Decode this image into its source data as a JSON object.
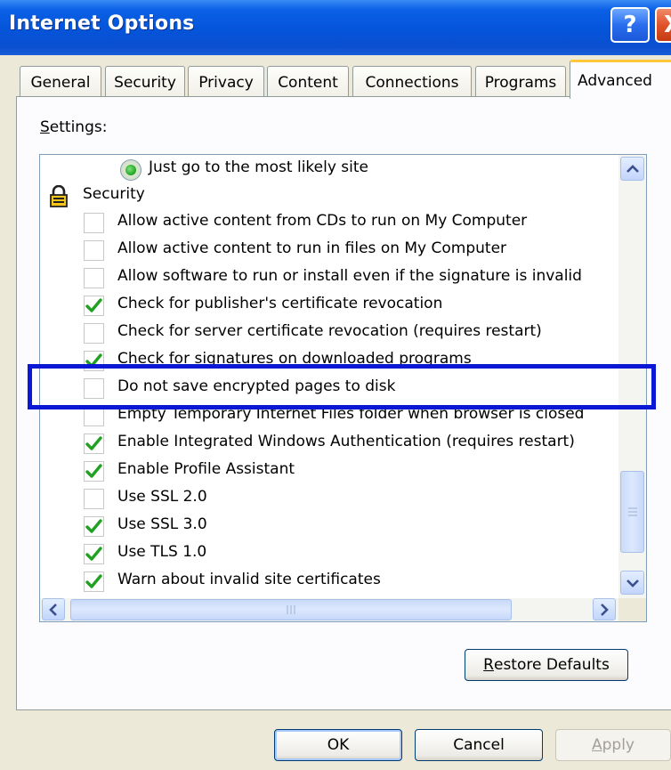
{
  "window": {
    "title": "Internet Options",
    "help_glyph": "?",
    "close_glyph": "X"
  },
  "tabs": [
    {
      "label": "General",
      "active": false
    },
    {
      "label": "Security",
      "active": false
    },
    {
      "label": "Privacy",
      "active": false
    },
    {
      "label": "Content",
      "active": false
    },
    {
      "label": "Connections",
      "active": false
    },
    {
      "label": "Programs",
      "active": false
    },
    {
      "label": "Advanced",
      "active": true
    }
  ],
  "settings": {
    "label_accel": "S",
    "label_rest": "ettings:",
    "items": [
      {
        "kind": "radio",
        "label": "Just go to the most likely site",
        "checked": true
      },
      {
        "kind": "group",
        "label": "Security",
        "icon": "lock-icon"
      },
      {
        "kind": "checkbox",
        "label": "Allow active content from CDs to run on My Computer",
        "checked": false
      },
      {
        "kind": "checkbox",
        "label": "Allow active content to run in files on My Computer",
        "checked": false
      },
      {
        "kind": "checkbox",
        "label": "Allow software to run or install even if the signature is invalid",
        "checked": false
      },
      {
        "kind": "checkbox",
        "label": "Check for publisher's certificate revocation",
        "checked": true
      },
      {
        "kind": "checkbox",
        "label": "Check for server certificate revocation (requires restart)",
        "checked": false
      },
      {
        "kind": "checkbox",
        "label": "Check for signatures on downloaded programs",
        "checked": true
      },
      {
        "kind": "checkbox",
        "label": "Do not save encrypted pages to disk",
        "checked": false
      },
      {
        "kind": "checkbox",
        "label": "Empty Temporary Internet Files folder when browser is closed",
        "checked": false
      },
      {
        "kind": "checkbox",
        "label": "Enable Integrated Windows Authentication (requires restart)",
        "checked": true
      },
      {
        "kind": "checkbox",
        "label": "Enable Profile Assistant",
        "checked": true
      },
      {
        "kind": "checkbox",
        "label": "Use SSL 2.0",
        "checked": false
      },
      {
        "kind": "checkbox",
        "label": "Use SSL 3.0",
        "checked": true
      },
      {
        "kind": "checkbox",
        "label": "Use TLS 1.0",
        "checked": true
      },
      {
        "kind": "checkbox",
        "label": "Warn about invalid site certificates",
        "checked": true
      }
    ]
  },
  "buttons": {
    "restore_accel": "R",
    "restore_rest": "estore Defaults",
    "ok": "OK",
    "cancel": "Cancel",
    "apply_accel": "A",
    "apply_rest": "pply"
  },
  "colors": {
    "highlight_box": "#0a18d6",
    "check_green": "#21a121"
  }
}
